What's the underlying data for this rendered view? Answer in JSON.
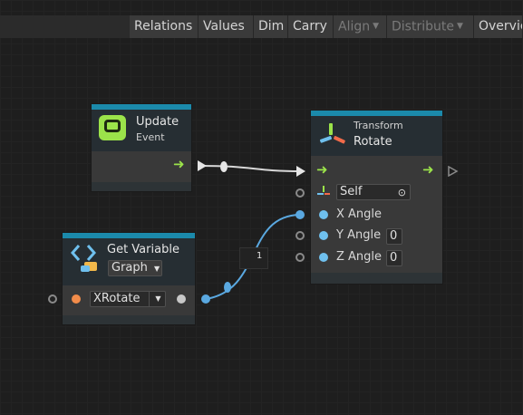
{
  "toolbar": {
    "buttons": [
      {
        "label": "Relations",
        "enabled": true
      },
      {
        "label": "Values",
        "enabled": true
      },
      {
        "label": "Dim",
        "enabled": true
      },
      {
        "label": "Carry",
        "enabled": true
      },
      {
        "label": "Align",
        "enabled": false,
        "dropdown": true
      },
      {
        "label": "Distribute",
        "enabled": false,
        "dropdown": true
      },
      {
        "label": "Overview",
        "enabled": true
      }
    ]
  },
  "nodes": {
    "update_event": {
      "title": "Update",
      "subtitle": "Event",
      "icon": "update-event-icon"
    },
    "get_variable": {
      "title": "Get Variable",
      "scope_value": "Graph",
      "variable_value": "XRotate",
      "icon": "get-variable-icon"
    },
    "transform_rotate": {
      "subtitle": "Transform",
      "title": "Rotate",
      "target_value": "Self",
      "inputs": [
        {
          "label": "X Angle",
          "value": ""
        },
        {
          "label": "Y Angle",
          "value": "0"
        },
        {
          "label": "Z Angle",
          "value": "0"
        }
      ],
      "icon": "transform-icon"
    }
  },
  "connection_label": "1",
  "colors": {
    "accent": "#1b8aab",
    "flow": "#9be34a",
    "value_wire": "#5aa8e0",
    "float_port": "#6fc0ee",
    "string_port": "#f28c4a"
  }
}
